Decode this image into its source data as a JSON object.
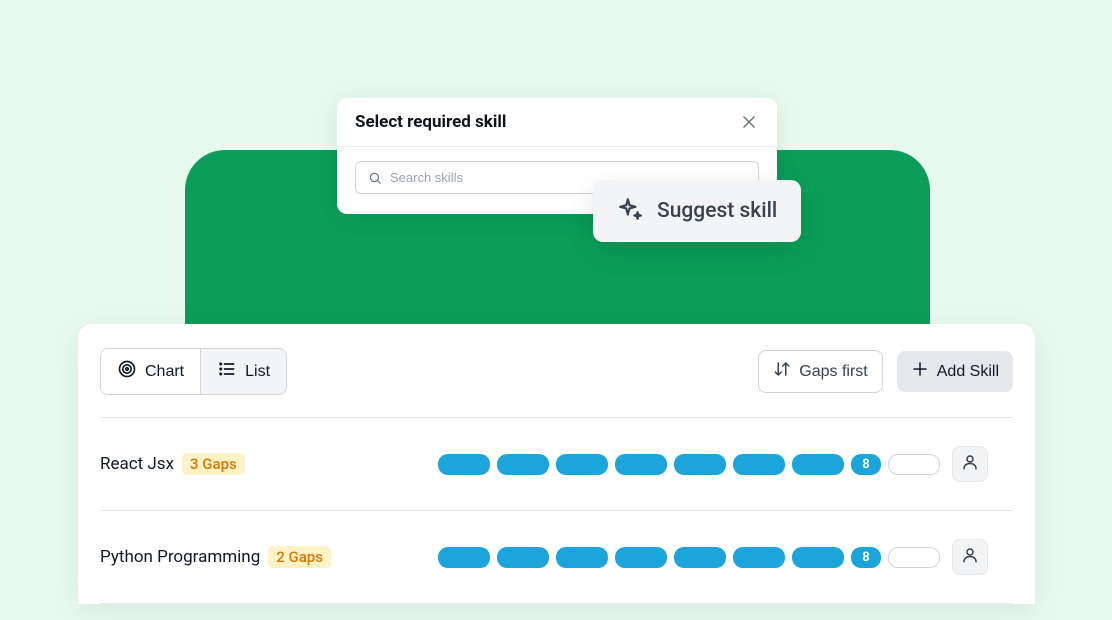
{
  "modal": {
    "title": "Select required skill",
    "searchPlaceholder": "Search skills"
  },
  "suggest": {
    "label": "Suggest skill"
  },
  "toolbar": {
    "chartLabel": "Chart",
    "listLabel": "List",
    "sortLabel": "Gaps first",
    "addLabel": "Add Skill"
  },
  "skills": [
    {
      "name": "React Jsx",
      "gapsLabel": "3 Gaps",
      "filled": 7,
      "levelNumber": "8",
      "empty": 1
    },
    {
      "name": "Python Programming",
      "gapsLabel": "2 Gaps",
      "filled": 7,
      "levelNumber": "8",
      "empty": 1
    }
  ]
}
